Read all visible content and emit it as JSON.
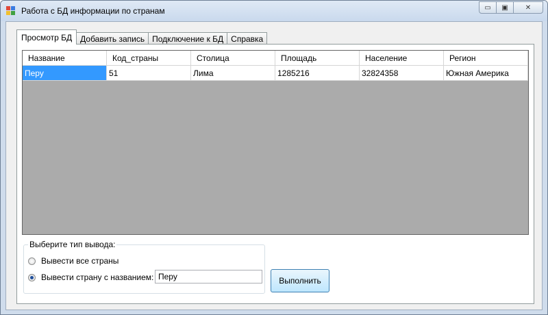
{
  "window": {
    "title": "Работа с БД информации по странам",
    "controls": {
      "minimize": "▭",
      "maximize": "▣",
      "close": "✕"
    }
  },
  "tabs": [
    {
      "label": "Просмотр БД",
      "active": true
    },
    {
      "label": "Добавить запись",
      "active": false
    },
    {
      "label": "Подключение к БД",
      "active": false
    },
    {
      "label": "Справка",
      "active": false
    }
  ],
  "grid": {
    "columns": [
      "Название",
      "Код_страны",
      "Столица",
      "Площадь",
      "Население",
      "Регион"
    ],
    "rows": [
      [
        "Перу",
        "51",
        "Лима",
        "1285216",
        "32824358",
        "Южная Америка"
      ]
    ]
  },
  "output_group": {
    "legend": "Выберите тип вывода:",
    "option_all": "Вывести все страны",
    "option_by_name": "Вывести страну с названием:",
    "selected": "by_name",
    "name_value": "Перу"
  },
  "execute_button": {
    "label": "Выполнить"
  }
}
